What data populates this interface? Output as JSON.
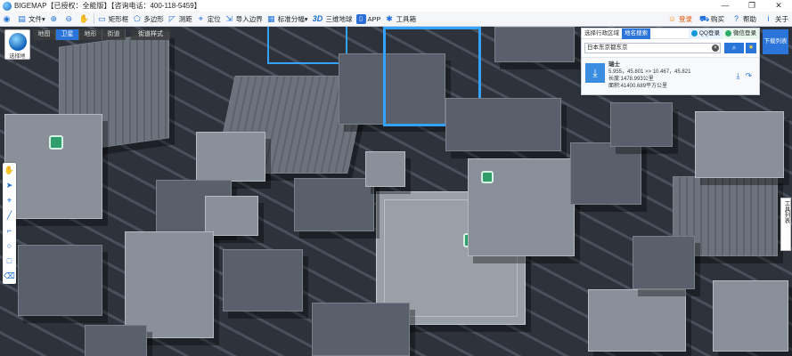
{
  "titlebar": {
    "title": "BIGEMAP【已授权：全能版】【咨询电话：400-118-5459】",
    "controls": [
      "—",
      "❐",
      "✕"
    ]
  },
  "toolbar": {
    "items": [
      {
        "label": "文件",
        "icon": "folder-icon",
        "glyph": "▤"
      },
      {
        "label": "",
        "icon": "zoom-in-icon",
        "glyph": "⊕"
      },
      {
        "label": "",
        "icon": "zoom-out-icon",
        "glyph": "⊖"
      },
      {
        "label": "",
        "icon": "pan-hand-icon",
        "glyph": "✋"
      },
      {
        "label": "矩形框",
        "icon": "rectangle-select-icon",
        "glyph": "▭"
      },
      {
        "label": "多边形",
        "icon": "polygon-select-icon",
        "glyph": "⬠"
      },
      {
        "label": "测距",
        "icon": "ruler-icon",
        "glyph": "📏"
      },
      {
        "label": "定位",
        "icon": "location-pin-icon",
        "glyph": "⌖"
      },
      {
        "label": "导入边界",
        "icon": "import-boundary-icon",
        "glyph": "⇲"
      },
      {
        "label": "标准分幅",
        "icon": "grid-icon",
        "glyph": "▦"
      },
      {
        "label": "三维地球",
        "icon": "3d-icon",
        "glyph": "3D"
      },
      {
        "label": "APP",
        "icon": "phone-icon",
        "glyph": "▯"
      },
      {
        "label": "工具箱",
        "icon": "toolbox-icon",
        "glyph": "✱"
      }
    ],
    "right": [
      {
        "label": "登录",
        "icon": "user-icon",
        "glyph": "☺"
      },
      {
        "label": "购买",
        "icon": "cart-icon",
        "glyph": "⛟"
      },
      {
        "label": "帮助",
        "icon": "help-icon",
        "glyph": "?"
      },
      {
        "label": "关于",
        "icon": "info-icon",
        "glyph": "i"
      }
    ]
  },
  "map": {
    "tabs": [
      {
        "label": "地图",
        "active": false
      },
      {
        "label": "卫星",
        "active": true
      },
      {
        "label": "地形",
        "active": false
      },
      {
        "label": "街道",
        "active": false
      }
    ],
    "street_style": "街道样式",
    "chooser_label": "选择地图..."
  },
  "search": {
    "tabs": [
      {
        "label": "选择行政区域",
        "active": false
      },
      {
        "label": "地名搜索",
        "active": true
      }
    ],
    "qq_login": "QQ登录",
    "wechat_login": "微信登录",
    "query": "日本东京都东京",
    "result": {
      "name": "瑞士",
      "coords": "5.955，45.801 >> 10.467，45.821",
      "length": "长度:1478.993公里",
      "area": "面积:41400.689平方公里"
    }
  },
  "download_list": "下载列表",
  "toolbox_label": "工具列表",
  "colors": {
    "accent": "#2b74d9",
    "satellite_tab": "#2b74d9"
  }
}
